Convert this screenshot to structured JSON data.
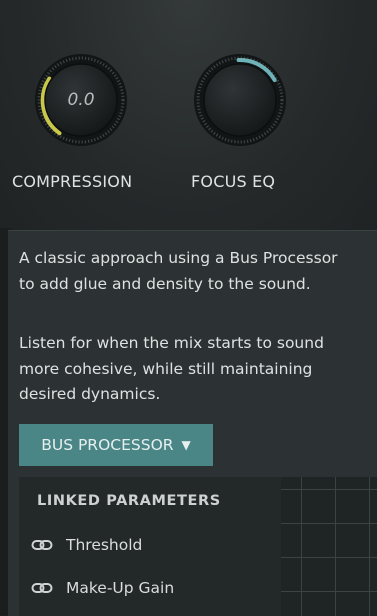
{
  "knobs": [
    {
      "label": "COMPRESSION",
      "value": "0.0",
      "level": 0.3,
      "accent": "#c9c84a"
    },
    {
      "label": "FOCUS EQ",
      "value": "",
      "level": 0.2,
      "accent": "#6fb2b8"
    }
  ],
  "info": {
    "description_1": "A classic approach using a Bus Processor to add glue and density to the sound.",
    "description_2": "Listen for when the mix starts to sound more cohesive, while still maintaining desired dynamics.",
    "module_dropdown": {
      "selected": "BUS PROCESSOR",
      "icon": "caret-down-icon"
    }
  },
  "linked_parameters": {
    "title": "LINKED PARAMETERS",
    "items": [
      {
        "label": "Threshold",
        "icon": "link-icon"
      },
      {
        "label": "Make-Up Gain",
        "icon": "link-icon"
      }
    ]
  },
  "colors": {
    "accent_teal": "#4b8687",
    "compression_ring": "#c9c84a",
    "focus_eq_ring": "#6fb2b8"
  }
}
